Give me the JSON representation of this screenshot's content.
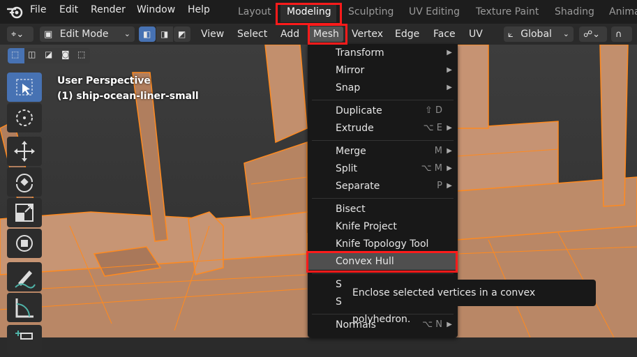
{
  "top_menu": [
    "File",
    "Edit",
    "Render",
    "Window",
    "Help"
  ],
  "workspace_tabs": [
    "Layout",
    "Modeling",
    "Sculpting",
    "UV Editing",
    "Texture Paint",
    "Shading",
    "Anima"
  ],
  "header": {
    "mode": "Edit Mode",
    "menus": [
      "View",
      "Select",
      "Add",
      "Mesh",
      "Vertex",
      "Edge",
      "Face",
      "UV"
    ],
    "orientation": "Global"
  },
  "viewport": {
    "perspective": "User Perspective",
    "object": "(1) ship-ocean-liner-small"
  },
  "mesh_menu": {
    "items": [
      {
        "label": "Transform",
        "shortcut": "",
        "submenu": true
      },
      {
        "label": "Mirror",
        "shortcut": "",
        "submenu": true
      },
      {
        "label": "Snap",
        "shortcut": "",
        "submenu": true
      },
      {
        "label": "Duplicate",
        "shortcut": "⇧ D",
        "submenu": false
      },
      {
        "label": "Extrude",
        "shortcut": "⌥ E",
        "submenu": true
      },
      {
        "label": "Merge",
        "shortcut": "M",
        "submenu": true
      },
      {
        "label": "Split",
        "shortcut": "⌥ M",
        "submenu": true
      },
      {
        "label": "Separate",
        "shortcut": "P",
        "submenu": true
      },
      {
        "label": "Bisect",
        "shortcut": "",
        "submenu": false
      },
      {
        "label": "Knife Project",
        "shortcut": "",
        "submenu": false
      },
      {
        "label": "Knife Topology Tool",
        "shortcut": "",
        "submenu": false
      },
      {
        "label": "Convex Hull",
        "shortcut": "",
        "submenu": false
      },
      {
        "label": "S",
        "shortcut": "",
        "submenu": false
      },
      {
        "label": "S",
        "shortcut": "",
        "submenu": false
      },
      {
        "label": "Normals",
        "shortcut": "⌥ N",
        "submenu": true
      }
    ]
  },
  "tooltip": "Enclose selected vertices in a convex polyhedron.",
  "colors": {
    "accent": "#4772b3",
    "highlight_box": "#ff1b1b",
    "mesh_orange": "#ff8a1f",
    "mesh_fill": "#c9906c"
  }
}
